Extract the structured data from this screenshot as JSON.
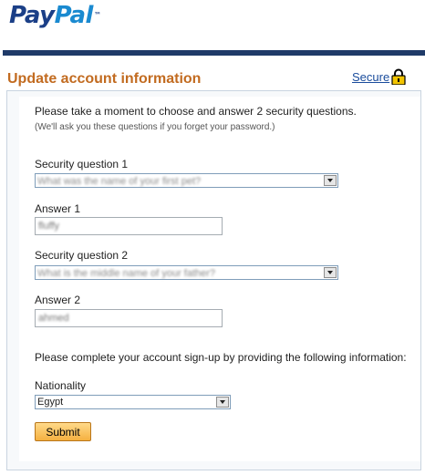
{
  "brand": {
    "logo_pay": "Pay",
    "logo_pal": "Pal",
    "logo_tm": "™"
  },
  "header": {
    "title": "Update account information",
    "secure_label": "Secure"
  },
  "form": {
    "intro": "Please take a moment to choose and answer 2 security questions.",
    "intro_note": "(We'll ask you these questions if you forget your password.)",
    "q1_label": "Security question 1",
    "q1_value": "What was the name of your first pet?",
    "a1_label": "Answer 1",
    "a1_value": "fluffy",
    "q2_label": "Security question 2",
    "q2_value": "What is the middle name of your father?",
    "a2_label": "Answer 2",
    "a2_value": "ahmed",
    "signup_text": "Please complete your account sign-up by providing the following information:",
    "nationality_label": "Nationality",
    "nationality_value": "Egypt",
    "submit_label": "Submit"
  },
  "colors": {
    "brand_dark": "#1b3f87",
    "brand_light": "#1a8ad0",
    "title_orange": "#c26b20",
    "bar": "#1f3a68"
  }
}
